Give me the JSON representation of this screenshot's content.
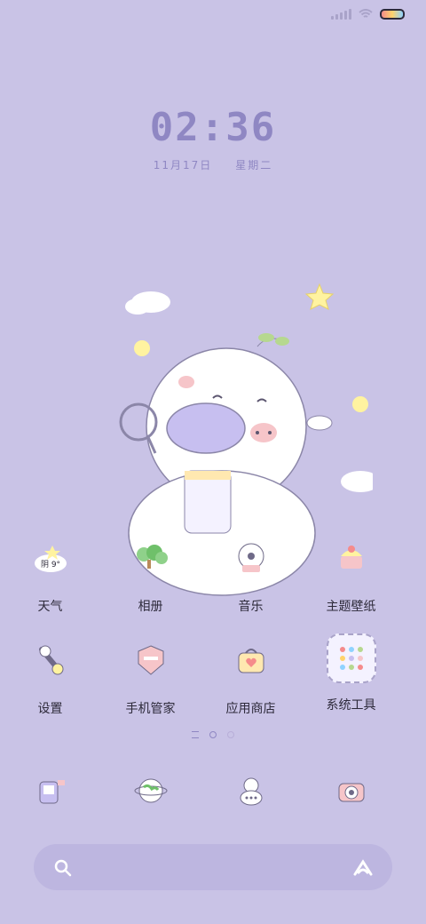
{
  "status": {
    "battery": "full"
  },
  "clock": {
    "time": "02:36",
    "date": "11月17日",
    "weekday": "星期二"
  },
  "apps_row1": [
    {
      "label": "天气",
      "icon": "weather-icon",
      "badge": "阴 9°"
    },
    {
      "label": "相册",
      "icon": "gallery-icon"
    },
    {
      "label": "音乐",
      "icon": "music-icon"
    },
    {
      "label": "主题壁纸",
      "icon": "theme-wallpaper-icon"
    }
  ],
  "apps_row2": [
    {
      "label": "设置",
      "icon": "settings-icon"
    },
    {
      "label": "手机管家",
      "icon": "phone-manager-icon"
    },
    {
      "label": "应用商店",
      "icon": "app-store-icon"
    },
    {
      "label": "系统工具",
      "icon": "system-tools-folder-icon"
    }
  ],
  "dock": [
    {
      "icon": "phone-dialer-icon"
    },
    {
      "icon": "browser-globe-icon"
    },
    {
      "icon": "messages-icon"
    },
    {
      "icon": "camera-icon"
    }
  ],
  "search": {
    "icon": "search-icon",
    "assistant_icon": "assistant-icon"
  }
}
